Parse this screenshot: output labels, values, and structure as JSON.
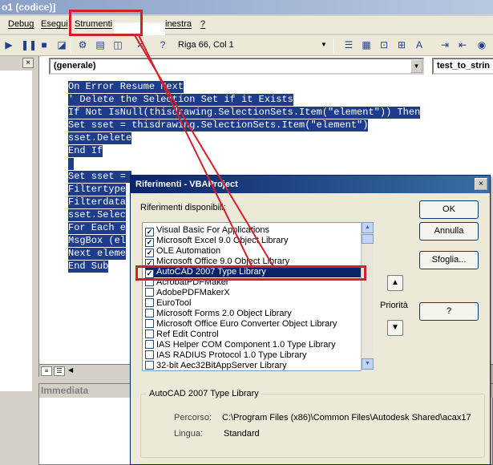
{
  "window": {
    "title": "o1 (codice)]"
  },
  "menu": {
    "debug": "Debug",
    "esegui": "Esegui",
    "strumenti": "Strumenti",
    "finestra": "inestra",
    "help": "?"
  },
  "toolbar": {
    "status": "Riga 66, Col 1"
  },
  "project_pane": {
    "close": "×"
  },
  "code_window": {
    "object_combo": "(generale)",
    "proc_combo": "test_to_strin",
    "lines": [
      "On Error Resume Next",
      "' Delete the Selection Set if it Exists",
      "If Not IsNull(thisdrawing.SelectionSets.Item(\"element\")) Then",
      "Set sset = thisdrawing.SelectionSets.Item(\"element\")",
      "sset.Delete",
      "End If",
      " ",
      "Set sset = ",
      "Filtertype",
      "Filterdata",
      "sset.Selec",
      "For Each e",
      "MsgBox (el",
      "Next eleme",
      "End Sub"
    ]
  },
  "immediate": {
    "title": "Immediata"
  },
  "dialog": {
    "title": "Riferimenti - VBAProject",
    "close": "×",
    "available_label": "Riferimenti disponibili:",
    "references": [
      {
        "name": "Visual Basic For Applications",
        "checked": true
      },
      {
        "name": "Microsoft Excel 9.0 Object Library",
        "checked": true
      },
      {
        "name": "OLE Automation",
        "checked": true
      },
      {
        "name": "Microsoft Office 9.0 Object Library",
        "checked": true
      },
      {
        "name": "AutoCAD 2007 Type Library",
        "checked": true,
        "selected": true
      },
      {
        "name": "AcrobatPDFMaker",
        "checked": false
      },
      {
        "name": "AdobePDFMakerX",
        "checked": false
      },
      {
        "name": "EuroTool",
        "checked": false
      },
      {
        "name": "Microsoft Forms 2.0 Object Library",
        "checked": false
      },
      {
        "name": "Microsoft Office Euro Converter Object Library",
        "checked": false
      },
      {
        "name": "Ref Edit Control",
        "checked": false
      },
      {
        "name": "IAS Helper COM Component 1.0 Type Library",
        "checked": false
      },
      {
        "name": "IAS RADIUS Protocol 1.0 Type Library",
        "checked": false
      },
      {
        "name": "32-bit Aec32BitAppServer Library",
        "checked": false
      }
    ],
    "buttons": {
      "ok": "OK",
      "cancel": "Annulla",
      "browse": "Sfoglia...",
      "help": "?"
    },
    "priority_label": "Priorità",
    "group_title": "AutoCAD 2007 Type Library",
    "path_label": "Percorso:",
    "path_value": "C:\\Program Files (x86)\\Common Files\\Autodesk Shared\\acax17",
    "language_label": "Lingua:",
    "language_value": "Standard"
  },
  "colors": {
    "highlight": "#1e3c8c",
    "annotation_red": "#d4202a",
    "dialog_title": "#0a246a"
  }
}
